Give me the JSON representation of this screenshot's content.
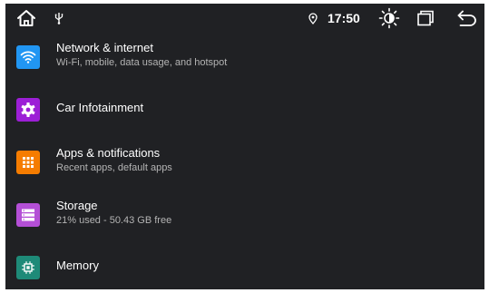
{
  "status_bar": {
    "time": "17:50",
    "icons": [
      "home-icon",
      "usb-icon",
      "location-icon",
      "brightness-icon",
      "recents-icon",
      "back-icon"
    ]
  },
  "settings": {
    "items": [
      {
        "title": "Network & internet",
        "subtitle": "Wi-Fi, mobile, data usage, and hotspot",
        "icon": "wifi-icon",
        "color": "#2196f3"
      },
      {
        "title": "Car Infotainment",
        "subtitle": "",
        "icon": "gear-icon",
        "color": "#9c1fd6"
      },
      {
        "title": "Apps & notifications",
        "subtitle": "Recent apps, default apps",
        "icon": "apps-grid-icon",
        "color": "#f57c00"
      },
      {
        "title": "Storage",
        "subtitle": "21% used - 50.43 GB free",
        "icon": "storage-icon",
        "color": "#b44fd6"
      },
      {
        "title": "Memory",
        "subtitle": "",
        "icon": "memory-chip-icon",
        "color": "#1e8a78"
      }
    ]
  }
}
